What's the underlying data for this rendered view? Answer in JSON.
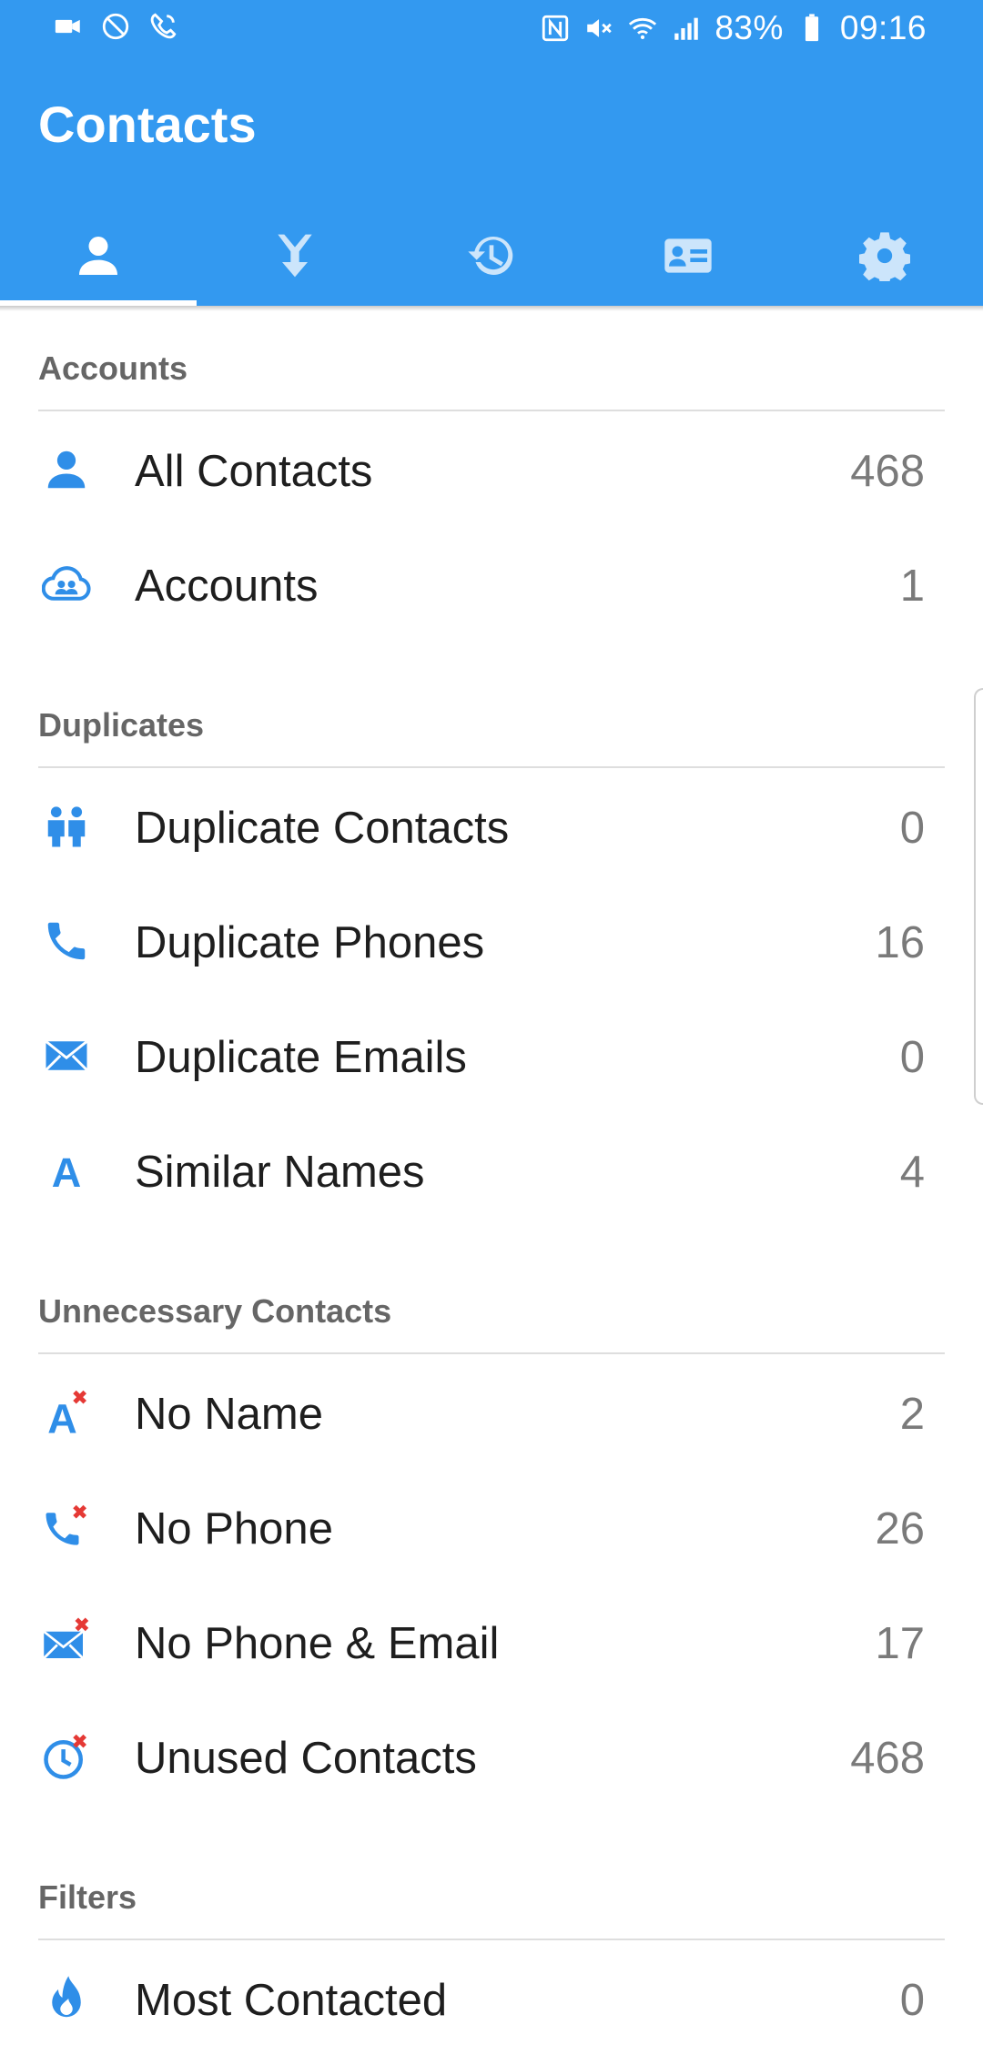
{
  "status_bar": {
    "battery": "83%",
    "time": "09:16"
  },
  "app": {
    "title": "Contacts",
    "tabs": [
      {
        "icon": "person-icon",
        "active": true
      },
      {
        "icon": "merge-icon",
        "active": false
      },
      {
        "icon": "history-icon",
        "active": false
      },
      {
        "icon": "contact-card-icon",
        "active": false
      },
      {
        "icon": "gear-icon",
        "active": false
      }
    ]
  },
  "sections": {
    "accounts": {
      "title": "Accounts",
      "items": [
        {
          "label": "All Contacts",
          "count": "468",
          "icon": "person-icon"
        },
        {
          "label": "Accounts",
          "count": "1",
          "icon": "cloud-group-icon"
        }
      ]
    },
    "duplicates": {
      "title": "Duplicates",
      "items": [
        {
          "label": "Duplicate Contacts",
          "count": "0",
          "icon": "people-icon"
        },
        {
          "label": "Duplicate Phones",
          "count": "16",
          "icon": "phone-icon"
        },
        {
          "label": "Duplicate Emails",
          "count": "0",
          "icon": "mail-icon"
        },
        {
          "label": "Similar Names",
          "count": "4",
          "icon": "letter-a-icon"
        }
      ]
    },
    "unnecessary": {
      "title": "Unnecessary Contacts",
      "items": [
        {
          "label": "No Name",
          "count": "2",
          "icon": "letter-a-x-icon"
        },
        {
          "label": "No Phone",
          "count": "26",
          "icon": "phone-x-icon"
        },
        {
          "label": "No Phone & Email",
          "count": "17",
          "icon": "mail-x-icon"
        },
        {
          "label": "Unused Contacts",
          "count": "468",
          "icon": "clock-x-icon"
        }
      ]
    },
    "filters": {
      "title": "Filters",
      "items": [
        {
          "label": "Most Contacted",
          "count": "0",
          "icon": "flame-icon"
        }
      ]
    }
  },
  "colors": {
    "primary": "#3399f0",
    "icon_blue": "#2f8ee8",
    "badge_red": "#e53935"
  }
}
